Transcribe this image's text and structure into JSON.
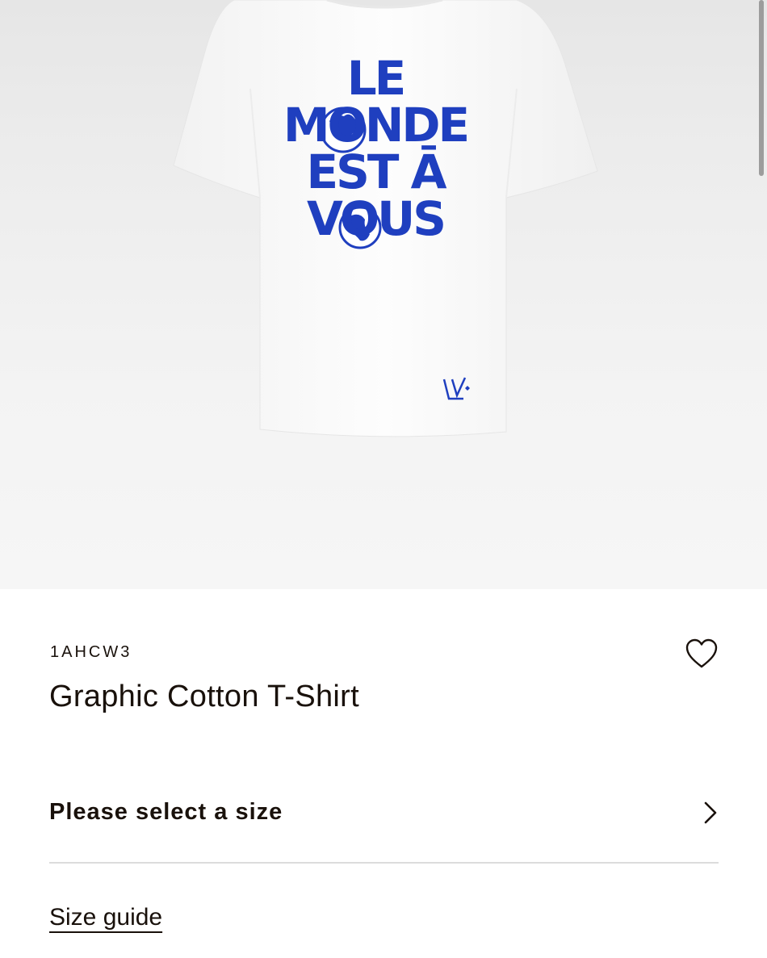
{
  "product": {
    "image": {
      "print_lines": [
        "LE",
        "MONDE",
        "EST Ā",
        "VOUS"
      ],
      "print_color": "#1f3fbf",
      "garment_color": "#fbfbfb"
    },
    "sku": "1AHCW3",
    "title": "Graphic Cotton T-Shirt",
    "wishlist_icon": "heart-outline-icon"
  },
  "size_selector": {
    "label": "Please select a size",
    "icon": "chevron-right-icon"
  },
  "size_guide": {
    "label": "Size guide"
  }
}
